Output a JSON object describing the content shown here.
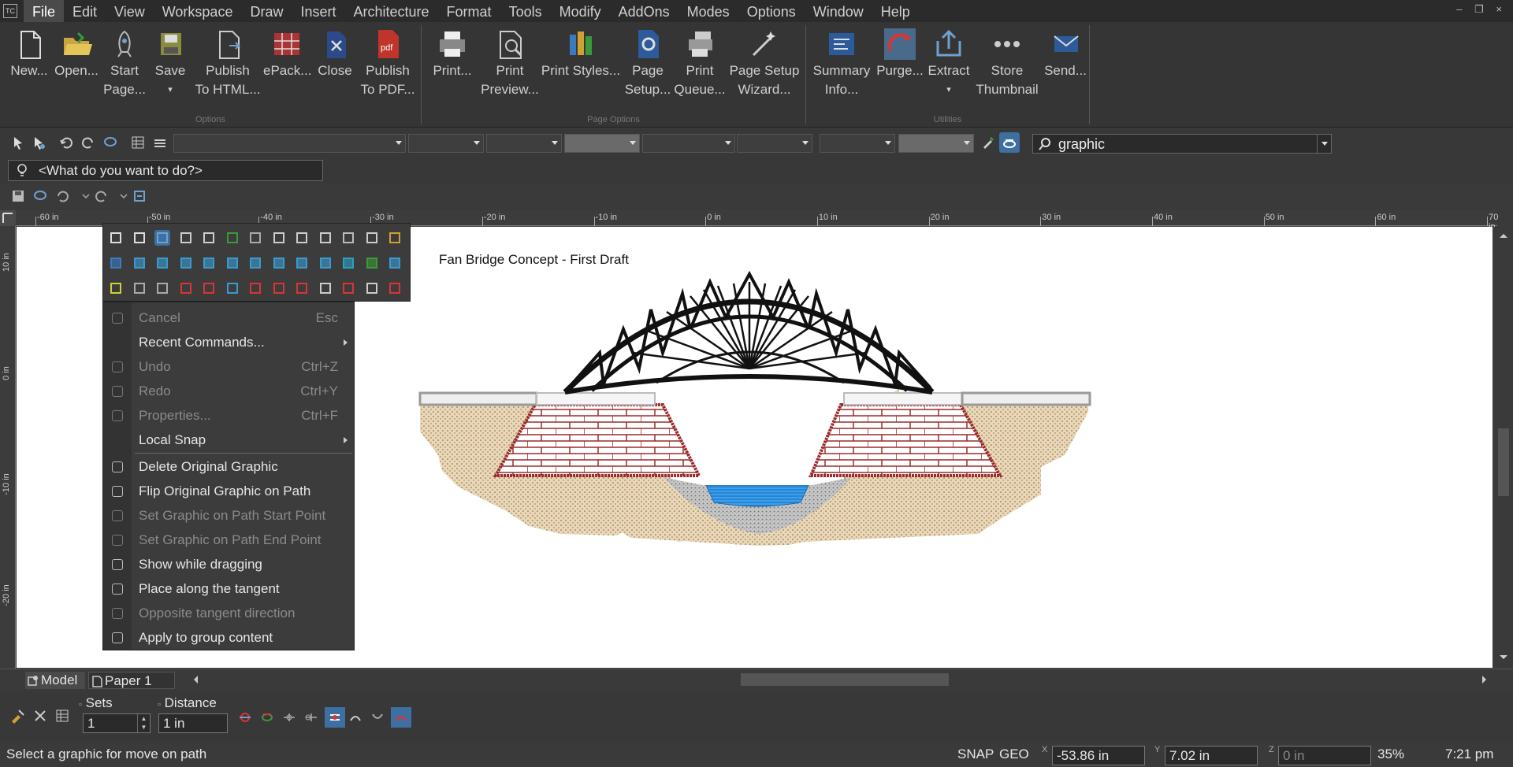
{
  "menubar": {
    "app_icon": "TC",
    "items": [
      "File",
      "Edit",
      "View",
      "Workspace",
      "Draw",
      "Insert",
      "Architecture",
      "Format",
      "Tools",
      "Modify",
      "AddOns",
      "Modes",
      "Options",
      "Window",
      "Help"
    ],
    "window_controls": "‒ ❐ ×"
  },
  "ribbon": {
    "groups": [
      {
        "label": "Options",
        "buttons": [
          {
            "line1": "New...",
            "line2": "",
            "icon": "new-document-icon"
          },
          {
            "line1": "Open...",
            "line2": "",
            "icon": "open-folder-icon"
          },
          {
            "line1": "Start",
            "line2": "Page...",
            "icon": "rocket-icon"
          },
          {
            "line1": "Save",
            "line2": "▾",
            "icon": "save-disk-icon"
          },
          {
            "line1": "Publish",
            "line2": "To HTML...",
            "icon": "publish-html-icon"
          },
          {
            "line1": "ePack...",
            "line2": "",
            "icon": "epack-icon"
          },
          {
            "line1": "Close",
            "line2": "",
            "icon": "close-document-icon"
          },
          {
            "line1": "Publish",
            "line2": "To PDF...",
            "icon": "pdf-icon"
          }
        ]
      },
      {
        "label": "Page Options",
        "buttons": [
          {
            "line1": "Print...",
            "line2": "",
            "icon": "printer-icon"
          },
          {
            "line1": "Print",
            "line2": "Preview...",
            "icon": "print-preview-icon"
          },
          {
            "line1": "Print Styles...",
            "line2": "",
            "icon": "print-styles-icon"
          },
          {
            "line1": "Page",
            "line2": "Setup...",
            "icon": "page-setup-icon"
          },
          {
            "line1": "Print",
            "line2": "Queue...",
            "icon": "print-queue-icon"
          },
          {
            "line1": "Page Setup",
            "line2": "Wizard...",
            "icon": "page-setup-wizard-icon"
          }
        ]
      },
      {
        "label": "Utilities",
        "buttons": [
          {
            "line1": "Summary",
            "line2": "Info...",
            "icon": "summary-info-icon"
          },
          {
            "line1": "Purge...",
            "line2": "",
            "icon": "purge-icon"
          },
          {
            "line1": "Extract",
            "line2": "▾",
            "icon": "extract-icon"
          },
          {
            "line1": "Store",
            "line2": "Thumbnail",
            "icon": "store-thumbnail-icon"
          },
          {
            "line1": "Send...",
            "line2": "",
            "icon": "send-mail-icon"
          }
        ]
      }
    ]
  },
  "search": {
    "value": "graphic"
  },
  "whatdo": {
    "placeholder": "<What do you want to do?>"
  },
  "ruler": {
    "h_labels": [
      "-60 in",
      "-50 in",
      "-40 in",
      "-30 in",
      "-20 in",
      "-10 in",
      "0 in",
      "10 in",
      "20 in",
      "30 in",
      "40 in",
      "50 in",
      "60 in",
      "70 in"
    ],
    "v_labels": [
      "10 in",
      "0 in",
      "-10 in",
      "-20 in"
    ]
  },
  "drawing": {
    "title": "Fan Bridge Concept - First Draft"
  },
  "context_menu": {
    "items": [
      {
        "label": "Cancel",
        "shortcut": "Esc",
        "disabled": true,
        "icon": "cancel-x-icon"
      },
      {
        "label": "Recent Commands...",
        "shortcut": "",
        "submenu": true,
        "icon": ""
      },
      {
        "label": "Undo",
        "shortcut": "Ctrl+Z",
        "disabled": true,
        "icon": "undo-icon"
      },
      {
        "label": "Redo",
        "shortcut": "Ctrl+Y",
        "disabled": true,
        "icon": "redo-icon"
      },
      {
        "label": "Properties...",
        "shortcut": "Ctrl+F",
        "disabled": true,
        "icon": "properties-icon"
      },
      {
        "label": "Local Snap",
        "shortcut": "",
        "submenu": true,
        "icon": ""
      },
      {
        "label": "Delete Original Graphic",
        "shortcut": "",
        "icon": "delete-original-graphic-icon"
      },
      {
        "label": "Flip Original Graphic on Path",
        "shortcut": "",
        "icon": "flip-graphic-icon"
      },
      {
        "label": "Set Graphic on Path Start Point",
        "shortcut": "",
        "disabled": true,
        "icon": "path-start-point-icon"
      },
      {
        "label": "Set Graphic on Path End Point",
        "shortcut": "",
        "disabled": true,
        "icon": "path-end-point-icon"
      },
      {
        "label": "Show while dragging",
        "shortcut": "",
        "icon": "show-dragging-icon"
      },
      {
        "label": "Place along the tangent",
        "shortcut": "",
        "icon": "tangent-icon"
      },
      {
        "label": "Opposite tangent direction",
        "shortcut": "",
        "disabled": true,
        "icon": "opposite-tangent-icon"
      },
      {
        "label": "Apply to group content",
        "shortcut": "",
        "icon": "group-content-icon"
      }
    ]
  },
  "tabs": {
    "model": "Model",
    "paper": "Paper 1"
  },
  "inspector": {
    "sets_label": "Sets",
    "sets_value": "1",
    "distance_label": "Distance",
    "distance_value": "1 in"
  },
  "status": {
    "prompt": "Select a graphic for move on path",
    "snap": "SNAP",
    "geo": "GEO",
    "x_label": "X",
    "x_value": "-53.86 in",
    "y_label": "Y",
    "y_value": "7.02 in",
    "z_label": "Z",
    "z_value": "0 in",
    "zoom": "35%",
    "time": "7:21 pm"
  },
  "colors": {
    "brick": "#9b2b2b",
    "soil": "#e8d8b8",
    "water": "#2a8be0",
    "truss": "#111111",
    "accent": "#3d8fd6"
  }
}
